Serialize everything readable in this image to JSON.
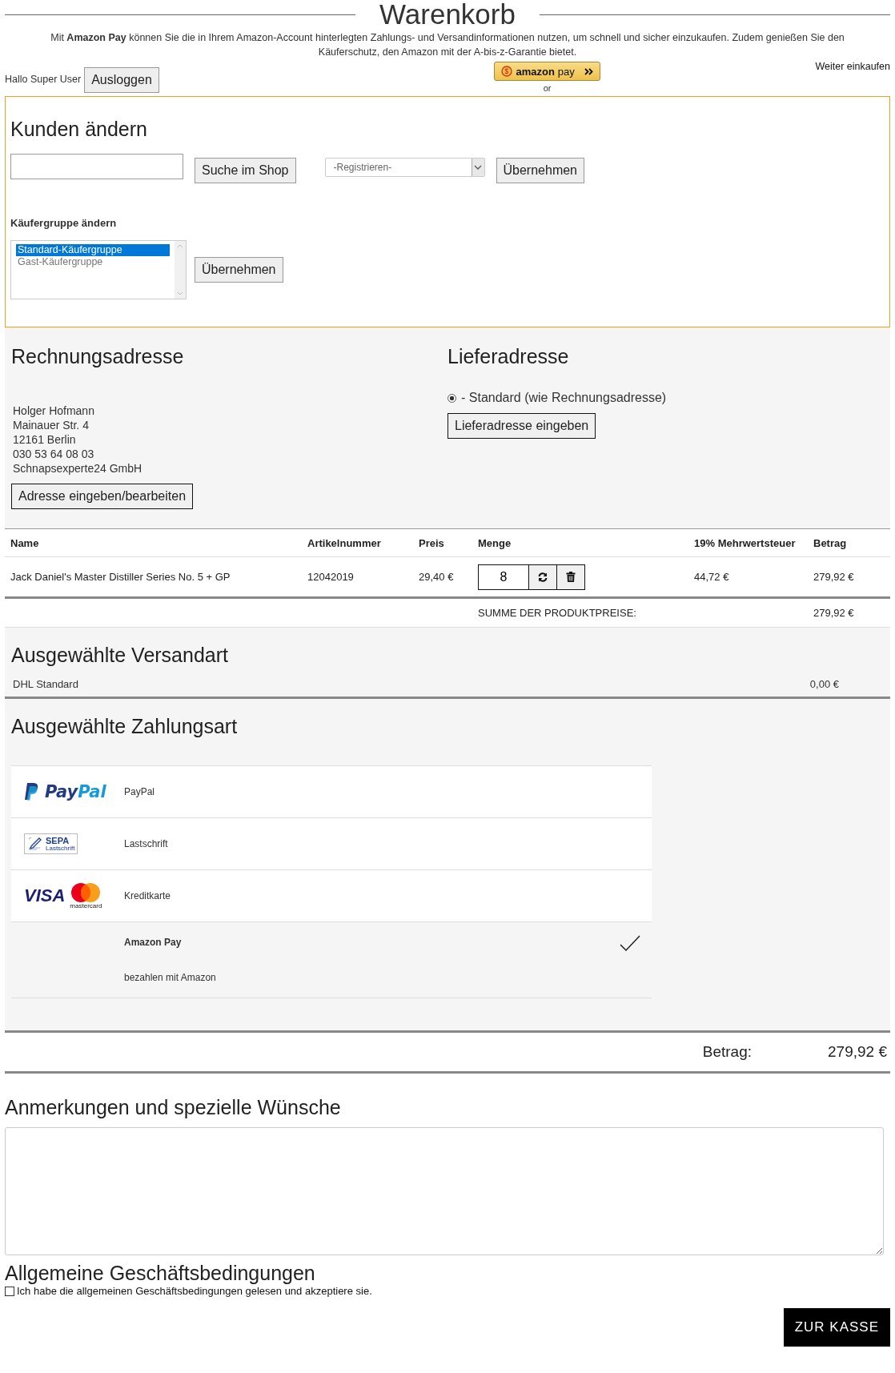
{
  "title": "Warenkorb",
  "amazon_info": "Mit **Amazon Pay** können Sie die in Ihrem Amazon-Account hinterlegten Zahlungs- und Versandinformationen nutzen, um schnell und sicher einzukaufen. Zudem genießen Sie den Käuferschutz, den Amazon mit der A-bis-z-Garantie bietet.",
  "continue_link": "Weiter einkaufen",
  "greeting": "Hallo Super User",
  "logout_button": "Ausloggen",
  "amazon_pay_button": {
    "brand": "amazon",
    "word": "pay"
  },
  "or_label": "or",
  "customer_panel": {
    "heading": "Kunden ändern",
    "search_button": "Suche im Shop",
    "select_value": "-Registrieren-",
    "apply_button": "Übernehmen",
    "group_label": "Käufergruppe ändern",
    "groups": [
      {
        "label": "Standard-Käufergruppe",
        "selected": true
      },
      {
        "label": "Gast-Käufergruppe",
        "selected": false
      }
    ],
    "group_apply_button": "Übernehmen"
  },
  "billing": {
    "heading": "Rechnungsadresse",
    "lines": [
      "Holger Hofmann",
      "Mainauer Str. 4",
      "12161 Berlin",
      "030 53 64 08 03",
      "Schnapsexperte24 GmbH"
    ],
    "button": "Adresse eingeben/bearbeiten"
  },
  "shipping": {
    "heading": "Lieferadresse",
    "option": {
      "label": "- Standard (wie Rechnungsadresse)",
      "selected": true
    },
    "button": "Lieferadresse eingeben"
  },
  "table": {
    "columns": [
      "Name",
      "Artikelnummer",
      "Preis",
      "Menge",
      "19% Mehrwertsteuer",
      "Betrag"
    ],
    "rows": [
      {
        "name": "Jack Daniel's Master Distiller Series No. 5 + GP",
        "sku": "12042019",
        "price": "29,40 €",
        "quantity": "8",
        "tax": "44,72 €",
        "amount": "279,92 €"
      }
    ],
    "sum_label": "SUMME DER PRODUKTPREISE:",
    "sum_value": "279,92 €"
  },
  "shipping_method": {
    "heading": "Ausgewählte Versandart",
    "name": "DHL Standard",
    "price": "0,00 €"
  },
  "payment": {
    "heading": "Ausgewählte Zahlungsart",
    "methods": [
      {
        "kind": "paypal",
        "logo": [
          "Pay",
          "Pal"
        ],
        "label": "PayPal",
        "selected": false
      },
      {
        "kind": "sepa",
        "logo": [
          "SEPA",
          "Lastschrift"
        ],
        "label": "Lastschrift",
        "selected": false
      },
      {
        "kind": "card",
        "logo": [
          "VISA",
          "mastercard"
        ],
        "label": "Kreditkarte",
        "selected": false
      },
      {
        "kind": "plain",
        "label": "Amazon Pay",
        "description": "bezahlen mit Amazon",
        "selected": true
      }
    ]
  },
  "total": {
    "label": "Betrag:",
    "value": "279,92 €"
  },
  "notes": {
    "heading": "Anmerkungen und spezielle Wünsche"
  },
  "terms": {
    "heading": "Allgemeine Geschäftsbedingungen",
    "label": "Ich habe die allgemeinen Geschäftsbedingungen gelesen und akzeptiere sie.",
    "checked": false
  },
  "checkout_button": "ZUR KASSE"
}
